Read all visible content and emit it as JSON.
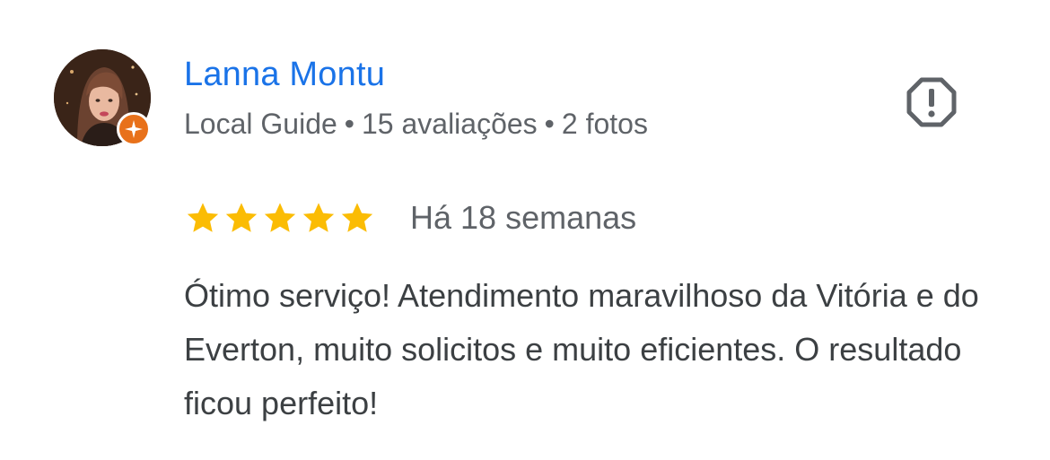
{
  "review": {
    "reviewer": {
      "name": "Lanna Montu",
      "level": "Local Guide",
      "reviews_count": "15 avaliações",
      "photos_count": "2 fotos",
      "separator": "•",
      "badge_icon": "local-guide-star-icon",
      "avatar_icon": "profile-photo"
    },
    "rating": {
      "stars": 5,
      "max": 5,
      "color": "#fbbc04"
    },
    "date": "Há 18 semanas",
    "text": "Ótimo serviço! Atendimento maravilhoso da Vitória e do Everton, muito solicitos e muito eficientes. O resultado ficou perfeito!",
    "report_icon": "report-flag-icon"
  },
  "colors": {
    "name": "#1a73e8",
    "meta": "#5f6368",
    "body": "#3c4043",
    "badge": "#e8711a",
    "star": "#fbbc04"
  }
}
